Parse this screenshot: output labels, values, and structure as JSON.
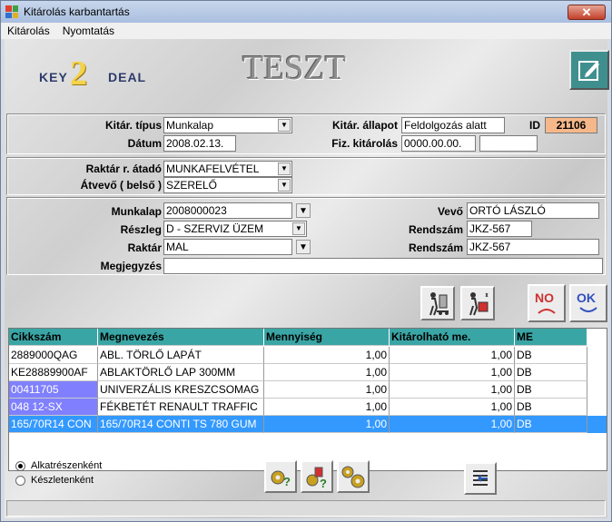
{
  "window": {
    "title": "Kitárolás karbantartás",
    "close_label": "✕"
  },
  "menu": {
    "items": [
      "Kitárolás",
      "Nyomtatás"
    ]
  },
  "header": {
    "logo_key": "KEY",
    "logo_two": "2",
    "logo_deal": "DEAL",
    "env_label": "TESZT"
  },
  "form": {
    "kitar_tipus_label": "Kitár. típus",
    "kitar_tipus_value": "Munkalap",
    "kitar_allapot_label": "Kitár. állapot",
    "kitar_allapot_value": "Feldolgozás alatt",
    "id_label": "ID",
    "id_value": "21106",
    "datum_label": "Dátum",
    "datum_value": "2008.02.13.",
    "fiz_kitarolas_label": "Fiz. kitárolás",
    "fiz_kitarolas_value": "0000.00.00.",
    "fiz_kitarolas_extra": "",
    "raktar_atado_label": "Raktár r. átadó",
    "raktar_atado_value": "MUNKAFELVÉTEL",
    "atvevo_label": "Átvevő ( belső )",
    "atvevo_value": "SZERELŐ",
    "munkalap_label": "Munkalap",
    "munkalap_value": "2008000023",
    "vevo_label": "Vevő",
    "vevo_value": "ORTÓ LÁSZLÓ",
    "reszleg_label": "Részleg",
    "reszleg_value": "D - SZERVIZ ÜZEM",
    "rendszam1_label": "Rendszám",
    "rendszam1_value": "JKZ-567",
    "raktar_label": "Raktár",
    "raktar_value": "MAL",
    "rendszam2_label": "Rendszám",
    "rendszam2_value": "JKZ-567",
    "megjegyzes_label": "Megjegyzés",
    "megjegyzes_value": ""
  },
  "buttons": {
    "no_label": "NO",
    "ok_label": "OK"
  },
  "table": {
    "columns": [
      "Cikkszám",
      "Megnevezés",
      "Mennyiség",
      "Kitárolható me.",
      "ME"
    ],
    "rows": [
      {
        "cikkszam": "2889000QAG",
        "megnevezes": "ABL. TÖRLŐ LAPÁT",
        "mennyiseg": "1,00",
        "kitarolhato": "1,00",
        "me": "DB"
      },
      {
        "cikkszam": "KE28889900AF",
        "megnevezes": "ABLAKTÖRLŐ LAP 300MM",
        "mennyiseg": "1,00",
        "kitarolhato": "1,00",
        "me": "DB"
      },
      {
        "cikkszam": "00411705",
        "megnevezes": "UNIVERZÁLIS KRESZCSOMAG",
        "mennyiseg": "1,00",
        "kitarolhato": "1,00",
        "me": "DB"
      },
      {
        "cikkszam": "048 12-SX",
        "megnevezes": "FÉKBETÉT RENAULT TRAFFIC",
        "mennyiseg": "1,00",
        "kitarolhato": "1,00",
        "me": "DB"
      },
      {
        "cikkszam": "165/70R14 CON",
        "megnevezes": "165/70R14 CONTI TS 780 GUM",
        "mennyiseg": "1,00",
        "kitarolhato": "1,00",
        "me": "DB"
      }
    ]
  },
  "options": {
    "alkatresz_label": "Alkatrészenként",
    "keszlet_label": "Készletenként",
    "selected": "Alkatrészenként"
  },
  "colors": {
    "header_teal": "#3aa5a5",
    "selected_row": "#3399ff",
    "purple_cell": "#8080ff",
    "id_orange": "#f6b88a"
  }
}
